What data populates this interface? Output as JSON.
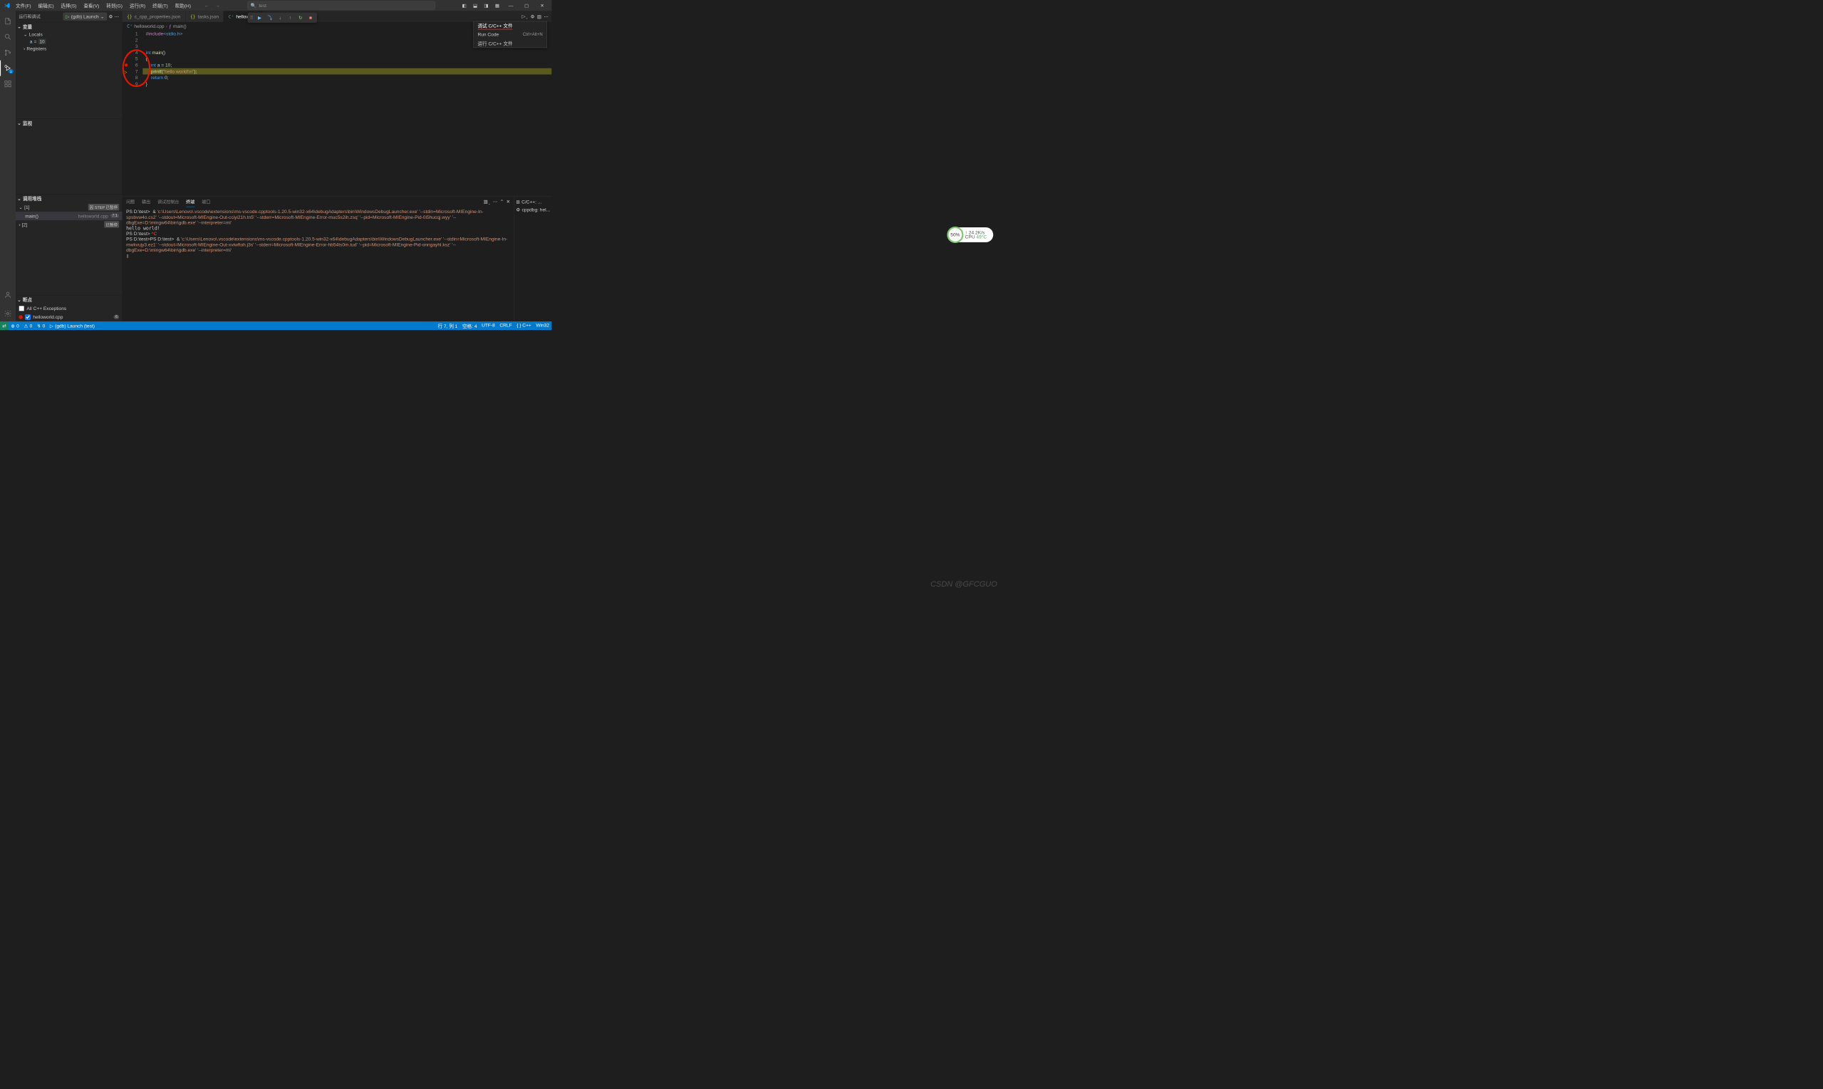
{
  "menubar": [
    "文件(F)",
    "编辑(E)",
    "选择(S)",
    "查看(V)",
    "转到(G)",
    "运行(R)",
    "终端(T)",
    "帮助(H)"
  ],
  "command_center": {
    "search_icon": "search-icon",
    "text": "test"
  },
  "sidebar": {
    "title": "运行和调试",
    "launch_config": "(gdb) Launch",
    "sections": {
      "variables": {
        "title": "变量",
        "locals_label": "Locals",
        "rows": [
          {
            "name": "a",
            "eq": "=",
            "val": "10"
          }
        ],
        "registers_label": "Registers"
      },
      "watch": {
        "title": "监视"
      },
      "callstack": {
        "title": "调用堆栈",
        "threads": [
          {
            "id": "[1]",
            "paused": "因 STEP 已暂停",
            "frames": [
              {
                "fn": "main()",
                "file": "helloworld.cpp",
                "loc": "7:1"
              }
            ]
          },
          {
            "id": "[2]",
            "paused": "已暂停"
          }
        ]
      },
      "breakpoints": {
        "title": "断点",
        "items": [
          {
            "checked": false,
            "label": "All C++ Exceptions",
            "dot": false
          },
          {
            "checked": true,
            "label": "helloworld.cpp",
            "dot": true,
            "count": "6"
          }
        ]
      }
    }
  },
  "tabs": [
    {
      "icon": "{}",
      "icon_class": "json",
      "label": "c_cpp_properties.json",
      "active": false
    },
    {
      "icon": "{}",
      "icon_class": "json",
      "label": "tasks.json",
      "active": false
    },
    {
      "icon": "C⁺",
      "icon_class": "cpp",
      "label": "hellowor...",
      "active": true
    }
  ],
  "debug_toolbar": [
    "continue",
    "step-over",
    "step-into",
    "step-out",
    "restart",
    "stop"
  ],
  "breadcrumbs": [
    {
      "icon": "C⁺",
      "text": "helloworld.cpp"
    },
    {
      "icon": "ƒ",
      "text": "main()"
    }
  ],
  "run_menu": [
    {
      "label": "调试 C/C++ 文件",
      "underline": true
    },
    {
      "label": "Run Code",
      "kbd": "Ctrl+Alt+N"
    },
    {
      "label": "运行 C/C++ 文件"
    }
  ],
  "code": {
    "lines": [
      {
        "n": 1,
        "html": "<span class='tok-pre'>#include</span><span class='tok-inc'>&lt;stdio.h&gt;</span>"
      },
      {
        "n": 2,
        "html": ""
      },
      {
        "n": 3,
        "html": ""
      },
      {
        "n": 4,
        "html": "<span class='tok-kw'>int</span> <span class='tok-fn'>main</span><span class='tok-punc'>()</span>"
      },
      {
        "n": 5,
        "html": "<span class='tok-punc'>{</span>"
      },
      {
        "n": 6,
        "bp": true,
        "html": "    <span class='tok-kw'>int</span> <span class='tok-var'>a</span> <span class='tok-punc'>=</span> <span class='tok-num'>10</span><span class='tok-punc'>;</span>"
      },
      {
        "n": 7,
        "current": true,
        "hl": true,
        "html": "    <span class='tok-fn'>printf</span><span class='tok-punc'>(</span><span class='tok-str'>\"hello world!\\n\"</span><span class='tok-punc'>);</span>"
      },
      {
        "n": 8,
        "html": "    <span class='tok-kw'>return</span> <span class='tok-num'>0</span><span class='tok-punc'>;</span>"
      },
      {
        "n": 9,
        "html": "<span class='tok-punc'>}</span>"
      }
    ]
  },
  "panel": {
    "tabs": [
      "问题",
      "输出",
      "调试控制台",
      "终端",
      "端口"
    ],
    "active_tab": "终端",
    "side": [
      {
        "icon": "⊞",
        "label": "C/C++: ..."
      },
      {
        "icon": "⚙",
        "label": "cppdbg: hel..."
      }
    ],
    "terminal_lines": [
      {
        "t": "prompt",
        "text": "PS D:\\test>  & "
      },
      {
        "t": "cmd",
        "text": "'c:\\Users\\Lenovo\\.vscode\\extensions\\ms-vscode.cpptools-1.20.5-win32-x64\\debugAdapters\\bin\\WindowsDebugLauncher.exe' '--stdin=Microsoft-MIEngine-In-spsbvw4o.cs2' '--stdout=Microsoft-MIEngine-Out-cciyi21h.tn5' '--stderr=Microsoft-MIEngine-Error-muc5s2ih.zsq' '--pid=Microsoft-MIEngine-Pid-0i5hucqj.wyy' '--dbgExe=D:\\mingw64\\bin\\gdb.exe' '--interpreter=mi'"
      },
      {
        "t": "out",
        "text": "hello world!"
      },
      {
        "t": "prompt",
        "text": "PS D:\\test> "
      },
      {
        "t": "red",
        "text": "^C"
      },
      {
        "t": "prompt",
        "text": "PS D:\\test>"
      },
      {
        "t": "prompt",
        "text": "PS D:\\test>  & "
      },
      {
        "t": "cmd",
        "text": "'c:\\Users\\Lenovo\\.vscode\\extensions\\ms-vscode.cpptools-1.20.5-win32-x64\\debugAdapters\\bin\\WindowsDebugLauncher.exe' '--stdin=Microsoft-MIEngine-In-mwkvujy3.ez1' '--stdout=Microsoft-MIEngine-Out-xviwftoh.j3s' '--stderr=Microsoft-MIEngine-Error-hb54ts0m.tud' '--pid=Microsoft-MIEngine-Pid-onngayhl.ksz' '--dbgExe=D:\\mingw64\\bin\\gdb.exe' '--interpreter=mi'"
      },
      {
        "t": "cursor",
        "text": "▯"
      }
    ]
  },
  "statusbar": {
    "left": [
      {
        "icon": "⊗",
        "text": "0"
      },
      {
        "icon": "⚠",
        "text": "0"
      },
      {
        "icon": "↯",
        "text": "0"
      },
      {
        "icon": "▷",
        "text": "(gdb) Launch (test)"
      }
    ],
    "right": [
      "行 7, 列 1",
      "空格: 4",
      "UTF-8",
      "CRLF",
      "{ }  C++",
      "Win32"
    ]
  },
  "activity_badge": "1",
  "watermark": "CSDN @GFCGUO",
  "perf": {
    "ring": "50%",
    "line1": "↑  24.2K/s",
    "line2_prefix": "CPU ",
    "temp": "49°C"
  }
}
